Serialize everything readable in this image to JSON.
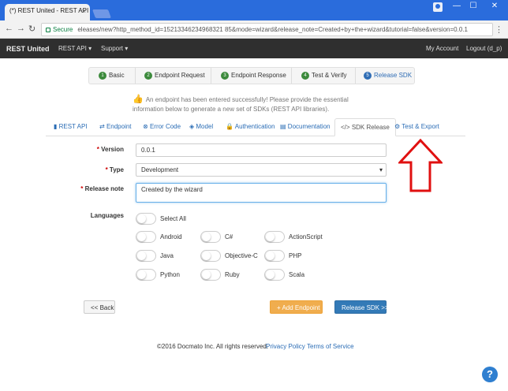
{
  "browser": {
    "tab_title": "(*) REST United - REST API",
    "tab_close": "×",
    "nav": {
      "back": "←",
      "forward": "→",
      "reload": "↻"
    },
    "secure_label": "Secure",
    "url": "eleases/new?http_method_id=15213346234968321 85&mode=wizard&release_note=Created+by+the+wizard&tutorial=false&version=0.0.1",
    "window_controls": {
      "minimize": "—",
      "maximize": "☐",
      "close": "✕"
    },
    "menu": "⋮"
  },
  "appnav": {
    "brand": "REST United",
    "menu_rest_api": "REST API ▾",
    "menu_support": "Support ▾",
    "my_account": "My Account",
    "logout": "Logout (d_p)"
  },
  "steps": [
    {
      "num": "1",
      "label": "Basic"
    },
    {
      "num": "2",
      "label": "Endpoint Request"
    },
    {
      "num": "3",
      "label": "Endpoint Response"
    },
    {
      "num": "4",
      "label": "Test & Verify"
    },
    {
      "num": "5",
      "label": "Release SDK"
    }
  ],
  "info_message": "An endpoint has been entered successfully! Please provide the essential information below to generate a new set of SDKs (REST API libraries).",
  "tabs": [
    {
      "icon": "▮",
      "label": "REST API"
    },
    {
      "icon": "⇄",
      "label": "Endpoint"
    },
    {
      "icon": "⊗",
      "label": "Error Code"
    },
    {
      "icon": "◈",
      "label": "Model"
    },
    {
      "icon": "🔒",
      "label": "Authentication"
    },
    {
      "icon": "▤",
      "label": "Documentation"
    },
    {
      "icon": "</>",
      "label": "SDK Release"
    },
    {
      "icon": "⚙",
      "label": "Test & Export"
    }
  ],
  "form": {
    "version_label": "Version",
    "version_value": "0.0.1",
    "type_label": "Type",
    "type_value": "Development",
    "release_note_label": "Release note",
    "release_note_value": "Created by the wizard",
    "languages_label": "Languages",
    "required_mark": "*"
  },
  "languages": {
    "select_all": "Select All",
    "col1": [
      "Android",
      "Java",
      "Python"
    ],
    "col2": [
      "C#",
      "Objective-C",
      "Ruby"
    ],
    "col3": [
      "ActionScript",
      "PHP",
      "Scala"
    ]
  },
  "buttons": {
    "back": "<< Back",
    "add_endpoint": "+ Add Endpoint",
    "release_sdk": "Release SDK >>"
  },
  "footer": {
    "copyright": "©2016 Docmato Inc. All rights reserved.",
    "privacy": "Privacy Policy",
    "terms": "Terms of Service"
  },
  "help": "?",
  "colors": {
    "annotation_arrow": "#e01010",
    "primary": "#337ab7",
    "warning": "#f0ad4e",
    "success_step": "#3c8a3c"
  }
}
